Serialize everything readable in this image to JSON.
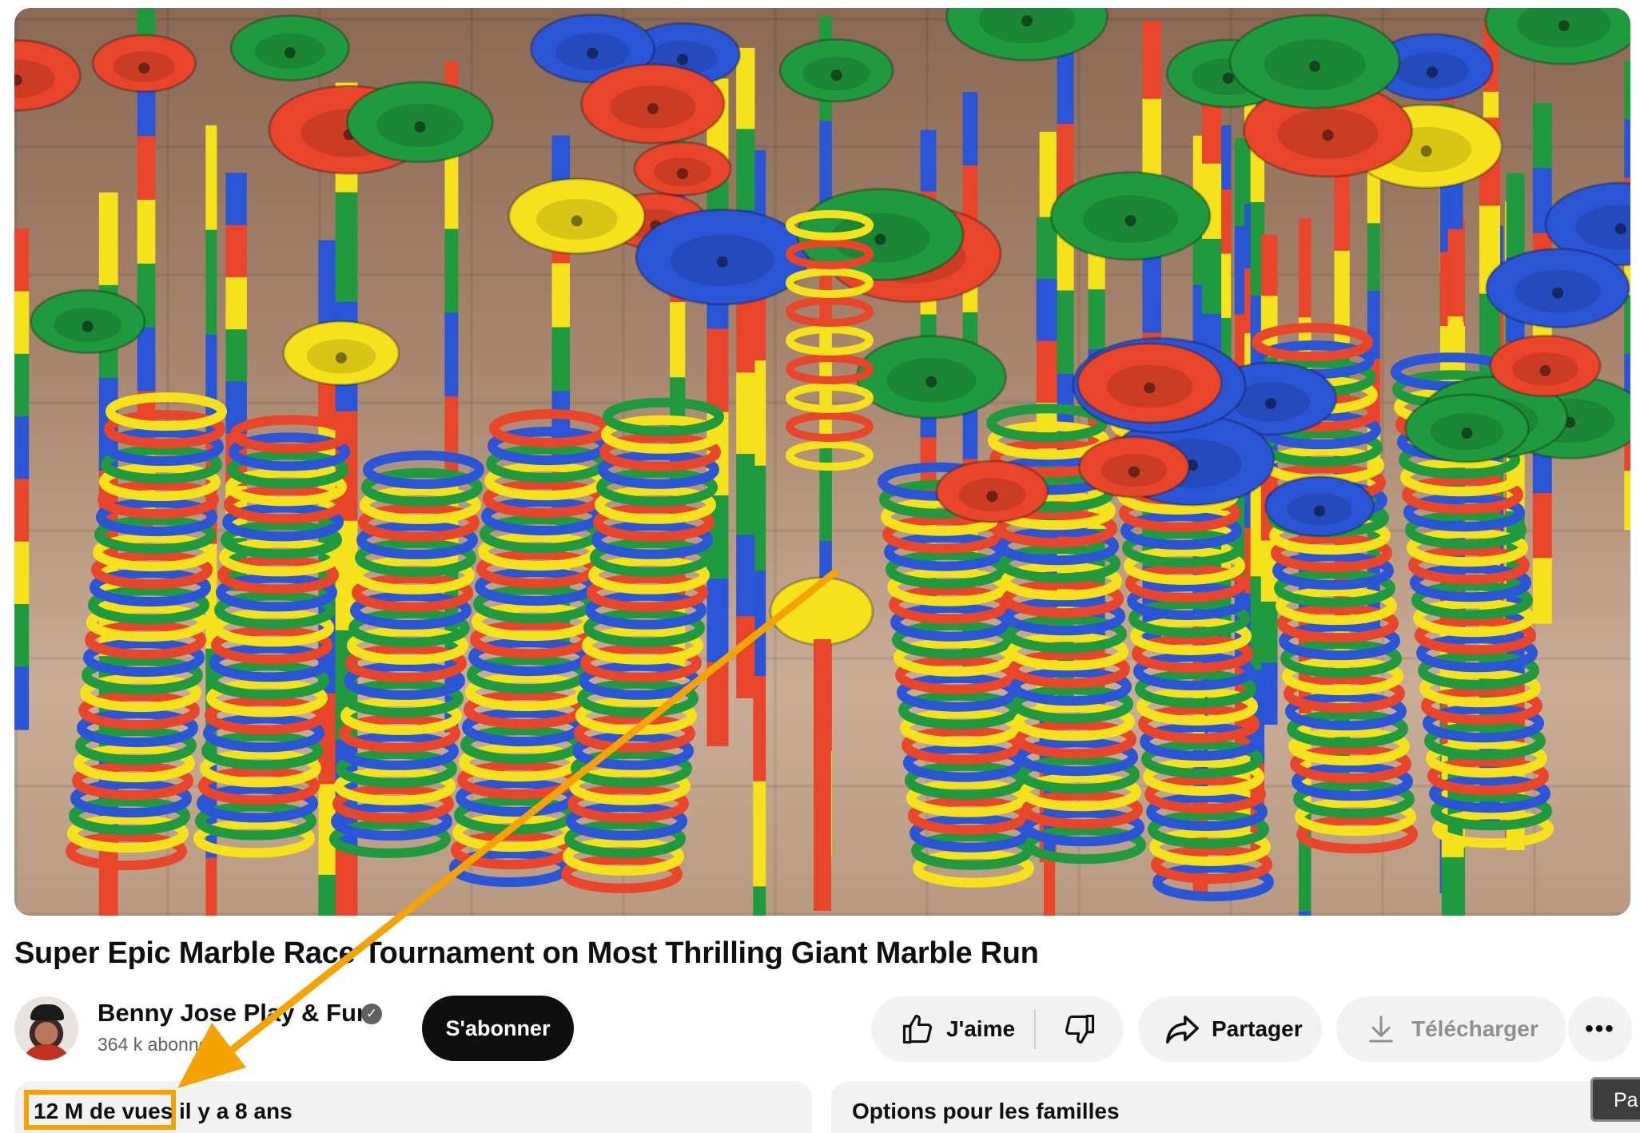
{
  "video": {
    "thumbnail_icon": "marble-run-thumbnail"
  },
  "title": "Super Epic Marble Race Tournament on Most Thrilling Giant Marble Run",
  "channel": {
    "name": "Benny Jose Play & Fun",
    "verified_icon": "✓",
    "subscribers": "364 k abonnés",
    "subscribe_label": "S'abonner"
  },
  "actions": {
    "like_label": "J'aime",
    "share_label": "Partager",
    "download_label": "Télécharger",
    "more_label": "•••"
  },
  "description": {
    "views": "12 M de vues",
    "age": "il y a 8 ans"
  },
  "family": {
    "label": "Options pour les familles"
  },
  "corner_button": {
    "label": "Pa"
  },
  "colors": {
    "annotation": "#f4a300",
    "subscribe_bg": "#0f0f0f",
    "pill_bg": "#f2f2f2",
    "marble_red": "#e8452a",
    "marble_yellow": "#f6e21a",
    "marble_green": "#1f9a3e",
    "marble_blue": "#2a55d6"
  }
}
